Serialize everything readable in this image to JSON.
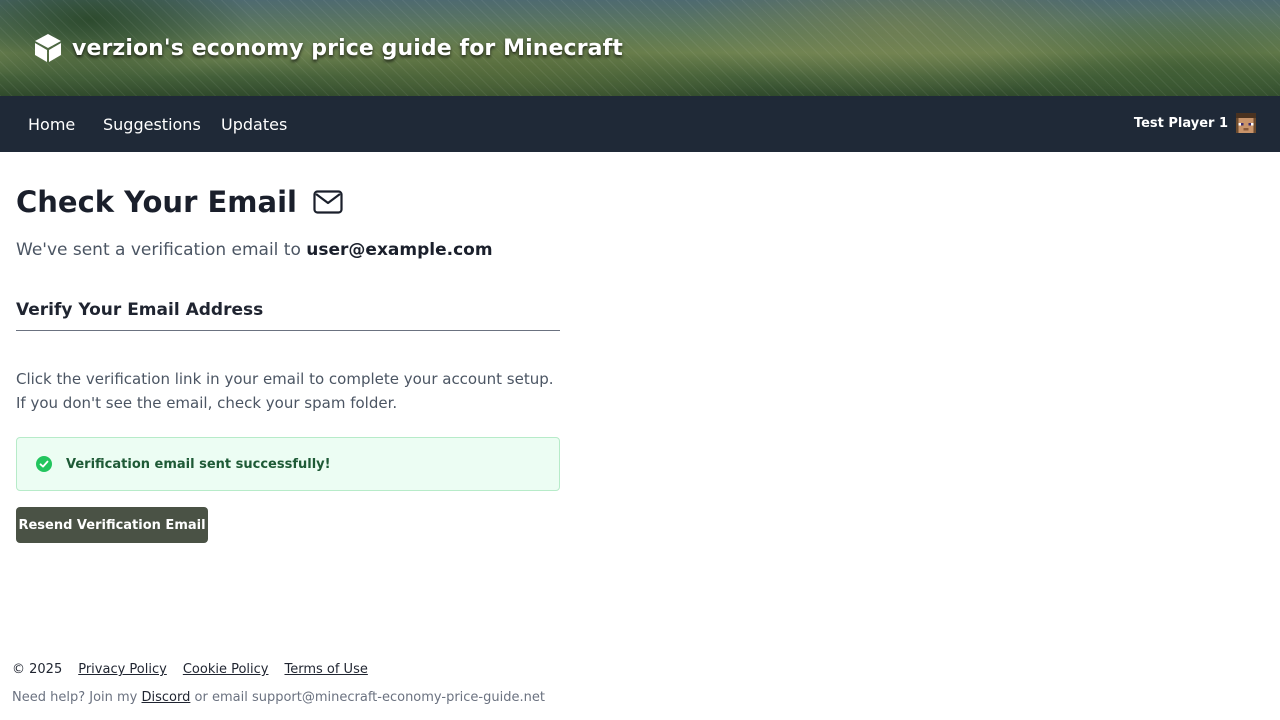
{
  "header": {
    "site_title": "verzion's economy price guide for Minecraft",
    "logo_icon": "cube-icon"
  },
  "nav": {
    "links": [
      {
        "label": "Home"
      },
      {
        "label": "Suggestions"
      },
      {
        "label": "Updates"
      }
    ],
    "user": {
      "name": "Test Player 1",
      "avatar_icon": "player-head-icon"
    }
  },
  "main": {
    "title": "Check Your Email",
    "title_icon": "mail-icon",
    "sent_prefix": "We've sent a verification email to",
    "email": "user@example.com",
    "section_title": "Verify Your Email Address",
    "instructions": "Click the verification link in your email to complete your account setup. If you don't see the email, check your spam folder.",
    "alert": {
      "icon": "check-circle-icon",
      "text": "Verification email sent successfully!",
      "color": "#22c55e"
    },
    "resend_label": "Resend Verification Email"
  },
  "footer": {
    "copyright": "© 2025",
    "links": [
      "Privacy Policy",
      "Cookie Policy",
      "Terms of Use"
    ],
    "help_prefix": "Need help? Join my",
    "discord_label": "Discord",
    "help_suffix": "or email support@minecraft-economy-price-guide.net"
  },
  "colors": {
    "nav_bg": "#1f2937",
    "button_bg": "#4a5245",
    "alert_bg": "#ecfdf3"
  }
}
